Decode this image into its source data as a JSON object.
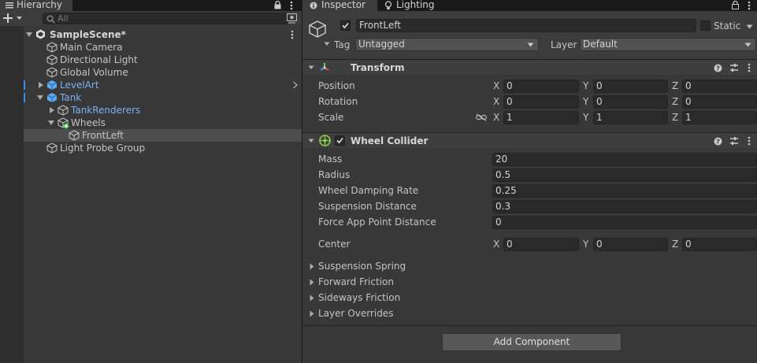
{
  "hierarchy": {
    "tab_label": "Hierarchy",
    "search_placeholder": "All",
    "scene_name": "SampleScene*",
    "items": [
      {
        "label": "Main Camera"
      },
      {
        "label": "Directional Light"
      },
      {
        "label": "Global Volume"
      },
      {
        "label": "LevelArt"
      },
      {
        "label": "Tank"
      },
      {
        "label": "TankRenderers"
      },
      {
        "label": "Wheels"
      },
      {
        "label": "FrontLeft"
      },
      {
        "label": "Light Probe Group"
      }
    ]
  },
  "inspector": {
    "tabs": [
      {
        "label": "Inspector"
      },
      {
        "label": "Lighting"
      }
    ],
    "object_name": "FrontLeft",
    "static_label": "Static",
    "tag_label": "Tag",
    "tag_value": "Untagged",
    "layer_label": "Layer",
    "layer_value": "Default",
    "transform": {
      "title": "Transform",
      "rows": [
        {
          "label": "Position",
          "x": "0",
          "y": "0",
          "z": "0"
        },
        {
          "label": "Rotation",
          "x": "0",
          "y": "0",
          "z": "0"
        },
        {
          "label": "Scale",
          "x": "1",
          "y": "1",
          "z": "1"
        }
      ]
    },
    "wheel_collider": {
      "title": "Wheel Collider",
      "fields": [
        {
          "label": "Mass",
          "value": "20"
        },
        {
          "label": "Radius",
          "value": "0.5"
        },
        {
          "label": "Wheel Damping Rate",
          "value": "0.25"
        },
        {
          "label": "Suspension Distance",
          "value": "0.3"
        },
        {
          "label": "Force App Point Distance",
          "value": "0"
        }
      ],
      "center": {
        "label": "Center",
        "x": "0",
        "y": "0",
        "z": "0"
      },
      "foldouts": [
        {
          "label": "Suspension Spring"
        },
        {
          "label": "Forward Friction"
        },
        {
          "label": "Sideways Friction"
        },
        {
          "label": "Layer Overrides"
        }
      ]
    },
    "axis_labels": {
      "x": "X",
      "y": "Y",
      "z": "Z"
    },
    "add_component_label": "Add Component"
  },
  "colors": {
    "panel_bg": "#383838",
    "field_bg": "#2a2a2a",
    "prefab_blue": "#7cb0f2",
    "selection": "#4d4d4d",
    "wheel_green": "#8fd14f"
  },
  "icons": [
    "hamburger-icon",
    "plus-icon",
    "search-icon",
    "lock-icon",
    "kebab-icon",
    "gameobject-icon",
    "unity-scene-icon",
    "prefab-icon",
    "transform-icon",
    "wheel-collider-icon",
    "help-icon",
    "preset-icon",
    "link-icon",
    "lightbulb-icon",
    "chevron-right-icon",
    "chevron-down-icon"
  ]
}
